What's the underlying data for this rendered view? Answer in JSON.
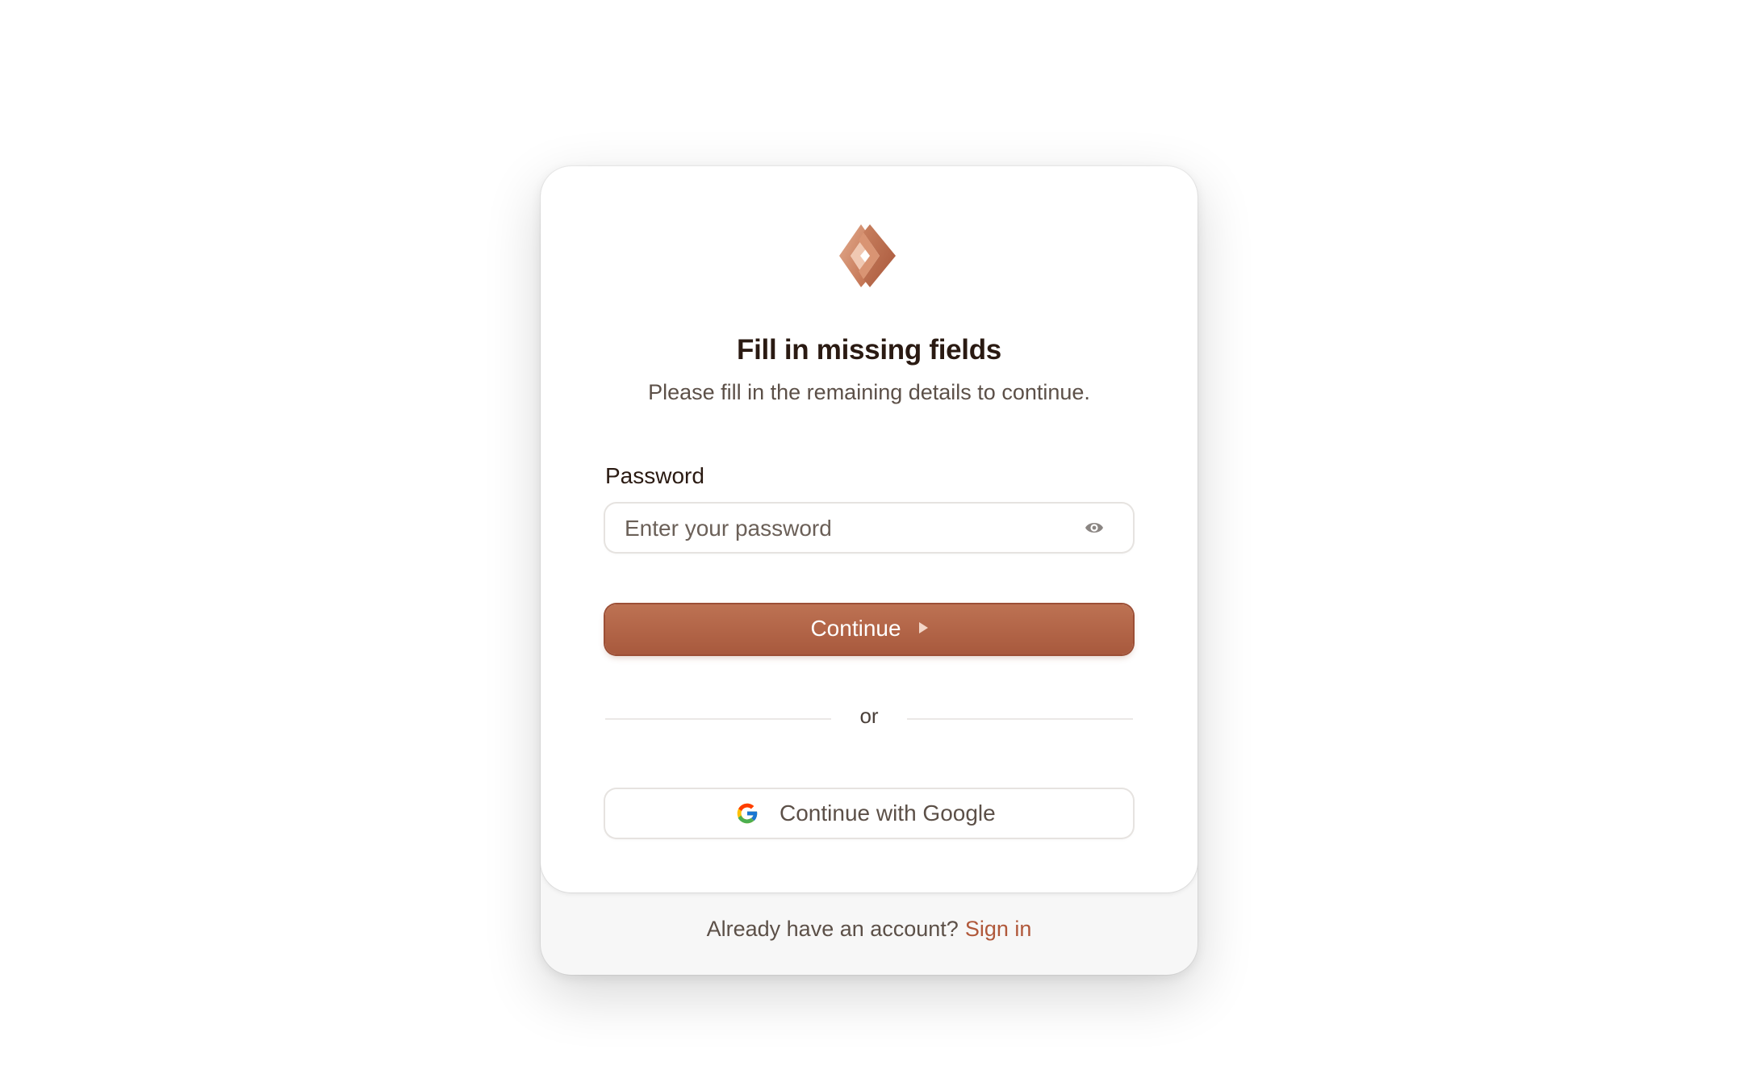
{
  "heading": {
    "title": "Fill in missing fields",
    "subtitle": "Please fill in the remaining details to continue."
  },
  "password_field": {
    "label": "Password",
    "placeholder": "Enter your password",
    "icon": "eye-icon"
  },
  "continue_button": {
    "label": "Continue",
    "icon": "triangle-right-icon"
  },
  "divider": {
    "text": "or"
  },
  "google_button": {
    "label": "Continue with Google",
    "icon": "google-icon"
  },
  "footer": {
    "prompt": "Already have an account?",
    "link": "Sign in"
  },
  "colors": {
    "accent": "#b0583a",
    "button": "#af6145",
    "title_text": "#2a1a12",
    "body_text": "#5c5048"
  }
}
